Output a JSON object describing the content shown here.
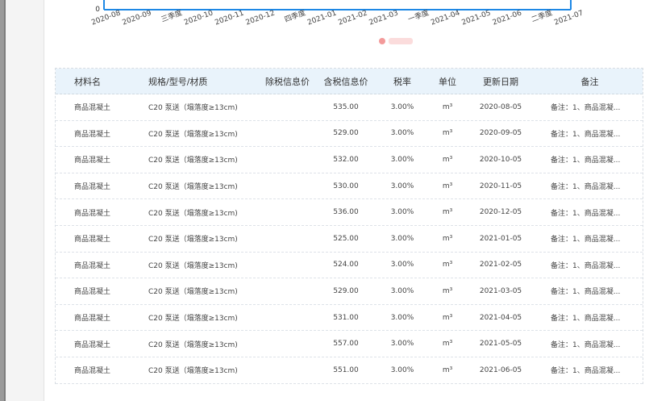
{
  "chart": {
    "y_tick": "0",
    "x_labels": [
      "2020-08",
      "2020-09",
      "三季度",
      "2020-10",
      "2020-11",
      "2020-12",
      "四季度",
      "2021-01",
      "2021-02",
      "2021-03",
      "一季度",
      "2021-04",
      "2021-05",
      "2021-06",
      "二季度",
      "2021-07"
    ],
    "axis_color": "#1e88e5",
    "legend_color": "#f39a9a"
  },
  "table": {
    "headers": {
      "name": "材料名",
      "spec": "规格/型号/材质",
      "price_pre_tax": "除税信息价",
      "price_tax": "含税信息价",
      "tax_rate": "税率",
      "unit": "单位",
      "date": "更新日期",
      "note": "备注"
    },
    "rows": [
      {
        "name": "商品混凝土",
        "spec": "C20 泵送（塌落度≥13cm)",
        "pre": "",
        "tax": "535.00",
        "rate": "3.00%",
        "unit": "m³",
        "date": "2020-08-05",
        "note": "备注：1、商品混凝..."
      },
      {
        "name": "商品混凝土",
        "spec": "C20 泵送（塌落度≥13cm)",
        "pre": "",
        "tax": "529.00",
        "rate": "3.00%",
        "unit": "m³",
        "date": "2020-09-05",
        "note": "备注：1、商品混凝..."
      },
      {
        "name": "商品混凝土",
        "spec": "C20 泵送（塌落度≥13cm)",
        "pre": "",
        "tax": "532.00",
        "rate": "3.00%",
        "unit": "m³",
        "date": "2020-10-05",
        "note": "备注：1、商品混凝..."
      },
      {
        "name": "商品混凝土",
        "spec": "C20 泵送（塌落度≥13cm)",
        "pre": "",
        "tax": "530.00",
        "rate": "3.00%",
        "unit": "m³",
        "date": "2020-11-05",
        "note": "备注：1、商品混凝..."
      },
      {
        "name": "商品混凝土",
        "spec": "C20 泵送（塌落度≥13cm)",
        "pre": "",
        "tax": "536.00",
        "rate": "3.00%",
        "unit": "m³",
        "date": "2020-12-05",
        "note": "备注：1、商品混凝..."
      },
      {
        "name": "商品混凝土",
        "spec": "C20 泵送（塌落度≥13cm)",
        "pre": "",
        "tax": "525.00",
        "rate": "3.00%",
        "unit": "m³",
        "date": "2021-01-05",
        "note": "备注：1、商品混凝..."
      },
      {
        "name": "商品混凝土",
        "spec": "C20 泵送（塌落度≥13cm)",
        "pre": "",
        "tax": "524.00",
        "rate": "3.00%",
        "unit": "m³",
        "date": "2021-02-05",
        "note": "备注：1、商品混凝..."
      },
      {
        "name": "商品混凝土",
        "spec": "C20 泵送（塌落度≥13cm)",
        "pre": "",
        "tax": "529.00",
        "rate": "3.00%",
        "unit": "m³",
        "date": "2021-03-05",
        "note": "备注：1、商品混凝..."
      },
      {
        "name": "商品混凝土",
        "spec": "C20 泵送（塌落度≥13cm)",
        "pre": "",
        "tax": "531.00",
        "rate": "3.00%",
        "unit": "m³",
        "date": "2021-04-05",
        "note": "备注：1、商品混凝..."
      },
      {
        "name": "商品混凝土",
        "spec": "C20 泵送（塌落度≥13cm)",
        "pre": "",
        "tax": "557.00",
        "rate": "3.00%",
        "unit": "m³",
        "date": "2021-05-05",
        "note": "备注：1、商品混凝..."
      },
      {
        "name": "商品混凝土",
        "spec": "C20 泵送（塌落度≥13cm)",
        "pre": "",
        "tax": "551.00",
        "rate": "3.00%",
        "unit": "m³",
        "date": "2021-06-05",
        "note": "备注：1、商品混凝..."
      }
    ]
  }
}
